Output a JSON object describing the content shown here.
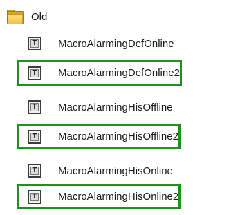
{
  "tree": {
    "folder": {
      "label": "Old",
      "icon": "folder-icon"
    },
    "items": [
      {
        "label": "MacroAlarmingDefOnline",
        "icon": "text-template-icon",
        "icon_glyph": "T",
        "highlighted": false
      },
      {
        "label": "MacroAlarmingDefOnline2",
        "icon": "text-template-icon",
        "icon_glyph": "T",
        "highlighted": true
      },
      {
        "label": "MacroAlarmingHisOffline",
        "icon": "text-template-icon",
        "icon_glyph": "T",
        "highlighted": false
      },
      {
        "label": "MacroAlarmingHisOffline2",
        "icon": "text-template-icon",
        "icon_glyph": "T",
        "highlighted": true
      },
      {
        "label": "MacroAlarmingHisOnline",
        "icon": "text-template-icon",
        "icon_glyph": "T",
        "highlighted": false
      },
      {
        "label": "MacroAlarmingHisOnline2",
        "icon": "text-template-icon",
        "icon_glyph": "T",
        "highlighted": true
      }
    ]
  },
  "colors": {
    "highlight_border": "#1f8f1f",
    "folder": "#f0c14b"
  }
}
